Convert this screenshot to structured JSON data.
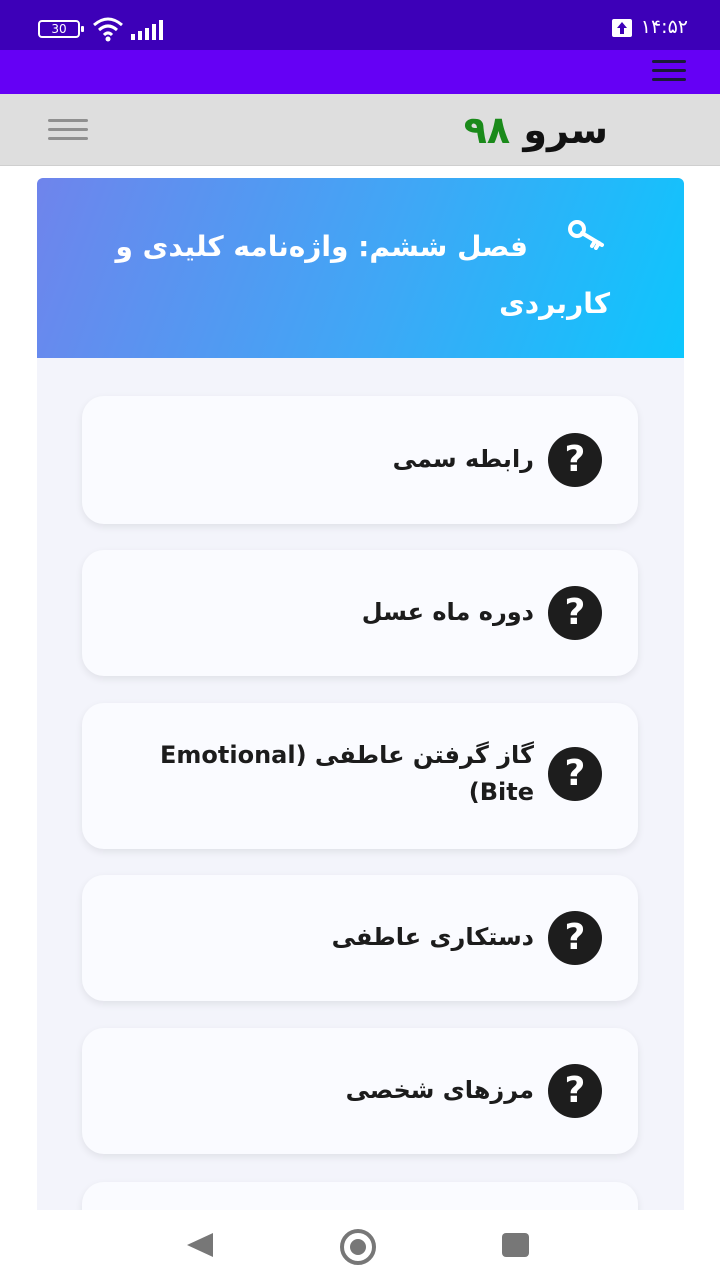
{
  "status_bar": {
    "time": "۱۴:۵۲",
    "battery": "30"
  },
  "header": {
    "logo_word1": "سرو",
    "logo_word2": "۹۸"
  },
  "chapter": {
    "title": "فصل ششم: واژه‌نامه کلیدی و کاربردی",
    "icon": "key-icon"
  },
  "items": [
    {
      "label": "رابطه سمی",
      "icon": "question-icon"
    },
    {
      "label": "دوره ماه عسل",
      "icon": "question-icon"
    },
    {
      "label": "گاز گرفتن عاطفی (Emotional Bite)",
      "icon": "question-icon"
    },
    {
      "label": "دستکاری عاطفی",
      "icon": "question-icon"
    },
    {
      "label": "مرزهای شخصی",
      "icon": "question-icon"
    }
  ],
  "colors": {
    "status_bar": "#3d00b8",
    "toolbar": "#6500f5",
    "header_gradient_start": "#6f84ec",
    "header_gradient_end": "#0dc6fd",
    "logo_accent": "#1a8a1a"
  }
}
